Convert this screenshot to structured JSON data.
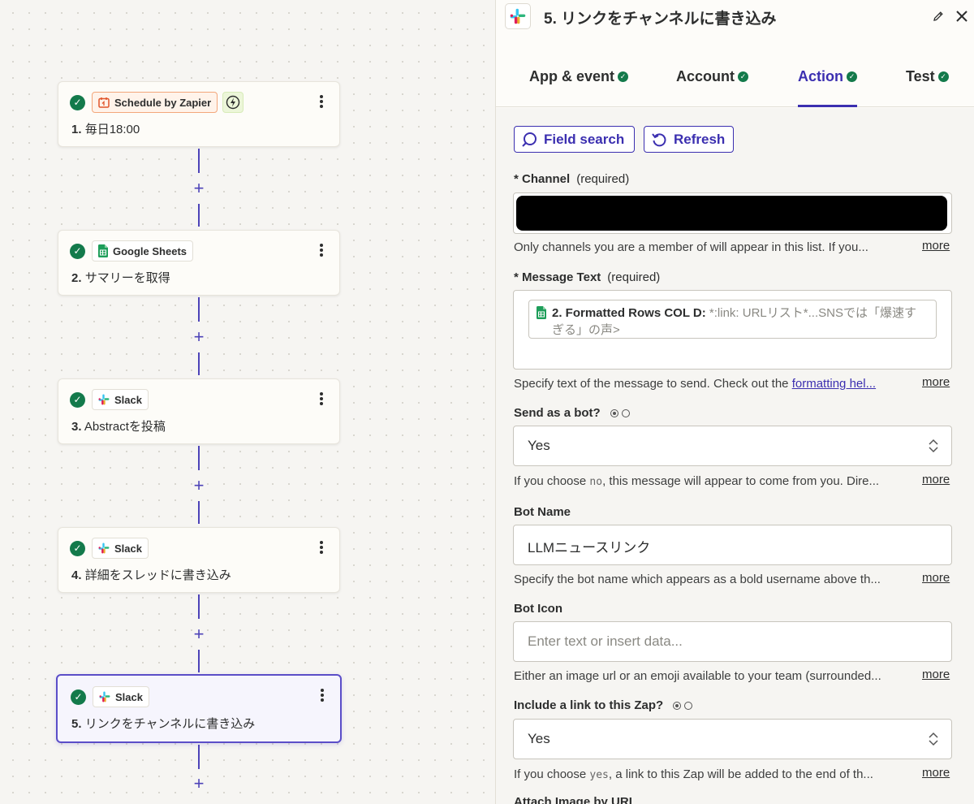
{
  "steps": [
    {
      "number": "1.",
      "title": "毎日18:00",
      "app": "Schedule by Zapier"
    },
    {
      "number": "2.",
      "title": "サマリーを取得",
      "app": "Google Sheets"
    },
    {
      "number": "3.",
      "title": "Abstractを投稿",
      "app": "Slack"
    },
    {
      "number": "4.",
      "title": "詳細をスレッドに書き込み",
      "app": "Slack"
    },
    {
      "number": "5.",
      "title": "リンクをチャンネルに書き込み",
      "app": "Slack"
    }
  ],
  "panel": {
    "title": "5. リンクをチャンネルに書き込み",
    "tabs": [
      "App & event",
      "Account",
      "Action",
      "Test"
    ],
    "field_search_label": "Field search",
    "refresh_label": "Refresh"
  },
  "fields": {
    "channel": {
      "label": "Channel",
      "required": "(required)",
      "help": "Only channels you are a member of will appear in this list. If you..."
    },
    "message_text": {
      "label": "Message Text",
      "required": "(required)",
      "pill_label": "2. Formatted Rows COL D:",
      "pill_value_1": "*:link: URLリスト*...SNSでは「爆速す",
      "pill_value_2": "ぎる」の声>",
      "help_prefix": "Specify text of the message to send. Check out the ",
      "help_link": "formatting hel..."
    },
    "send_as_bot": {
      "label": "Send as a bot?",
      "value": "Yes",
      "help_prefix": "If you choose ",
      "help_code": "no",
      "help_suffix": ", this message will appear to come from you. Dire..."
    },
    "bot_name": {
      "label": "Bot Name",
      "value": "LLMニュースリンク",
      "help": "Specify the bot name which appears as a bold username above th..."
    },
    "bot_icon": {
      "label": "Bot Icon",
      "placeholder": "Enter text or insert data...",
      "help": "Either an image url or an emoji available to your team (surrounded..."
    },
    "include_link": {
      "label": "Include a link to this Zap?",
      "value": "Yes",
      "help_prefix": "If you choose ",
      "help_code": "yes",
      "help_suffix": ", a link to this Zap will be added to the end of th..."
    },
    "attach_image": {
      "label": "Attach Image by URL"
    }
  },
  "more_label": "more",
  "colors": {
    "accent": "#3b2fb0",
    "success": "#137a4b",
    "connector": "#4d43b8"
  }
}
